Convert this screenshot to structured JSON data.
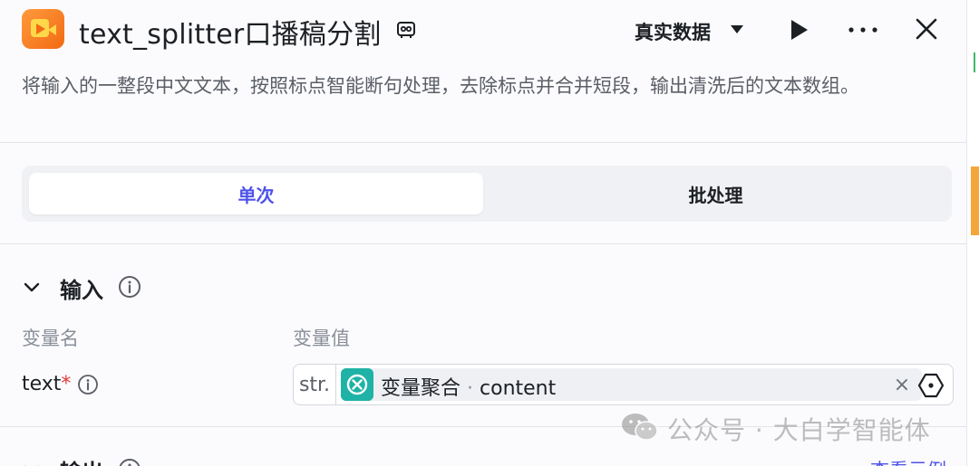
{
  "header": {
    "title": "text_splitter口播稿分割",
    "mode_select": "真实数据",
    "icons": [
      "video-app-icon",
      "node-link-icon",
      "play-icon",
      "more-icon",
      "close-icon"
    ]
  },
  "description": "将输入的一整段中文文本，按照标点智能断句处理，去除标点并合并短段，输出清洗后的文本数组。",
  "tabs": [
    {
      "label": "单次",
      "active": true
    },
    {
      "label": "批处理",
      "active": false
    }
  ],
  "input_section": {
    "title": "输入",
    "columns": {
      "name": "变量名",
      "value": "变量值"
    },
    "rows": [
      {
        "name": "text",
        "required_mark": "*",
        "type": "str.",
        "ref_node": "变量聚合",
        "ref_sep": "·",
        "ref_field": "content",
        "clear": "×"
      }
    ]
  },
  "output_section": {
    "title": "输出",
    "link": "查看示例"
  },
  "watermark": "公众号 · 大白学智能体",
  "colors": {
    "accent": "#4d53e8",
    "required": "#e53935",
    "ref_icon": "#1fb2a6",
    "app_icon": "#f26a13"
  }
}
